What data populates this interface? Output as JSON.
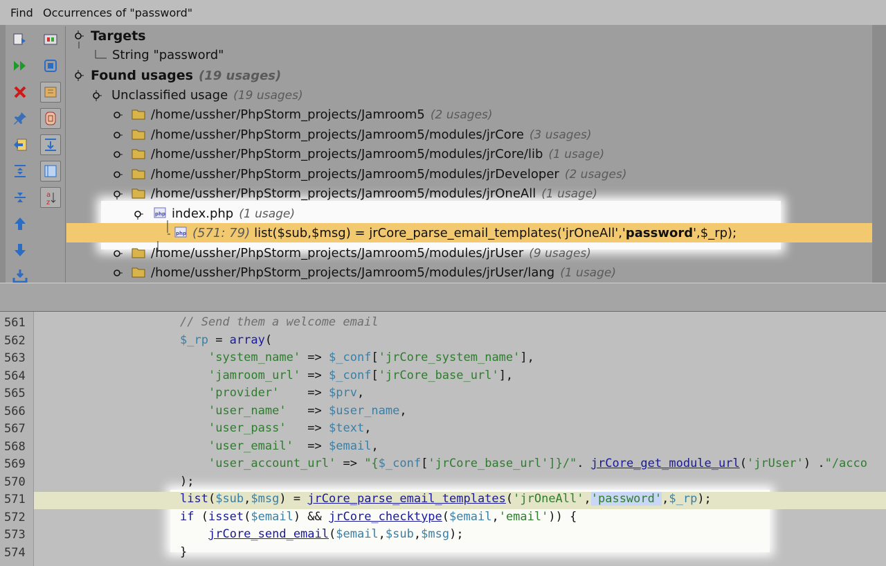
{
  "titlebar": {
    "label": "Find",
    "title": "Occurrences of \"password\""
  },
  "tree": {
    "targets": "Targets",
    "target_item": "String \"password\"",
    "found": "Found usages",
    "found_count": "(19 usages)",
    "unclassified": "Unclassified usage",
    "unclassified_count": "(19 usages)",
    "folders": [
      {
        "path": "/home/ussher/PhpStorm_projects/Jamroom5",
        "count": "(2 usages)"
      },
      {
        "path": "/home/ussher/PhpStorm_projects/Jamroom5/modules/jrCore",
        "count": "(3 usages)"
      },
      {
        "path": "/home/ussher/PhpStorm_projects/Jamroom5/modules/jrCore/lib",
        "count": "(1 usage)"
      },
      {
        "path": "/home/ussher/PhpStorm_projects/Jamroom5/modules/jrDeveloper",
        "count": "(2 usages)"
      },
      {
        "path": "/home/ussher/PhpStorm_projects/Jamroom5/modules/jrOneAll",
        "count": "(1 usage)"
      },
      {
        "path": "/home/ussher/PhpStorm_projects/Jamroom5/modules/jrUser",
        "count": "(9 usages)"
      },
      {
        "path": "/home/ussher/PhpStorm_projects/Jamroom5/modules/jrUser/lang",
        "count": "(1 usage)"
      }
    ],
    "file": "index.php",
    "file_count": "(1 usage)",
    "usage_pos": "(571: 79)",
    "usage_pre": "list($sub,$msg) = jrCore_parse_email_templates('jrOneAll','",
    "usage_match": "password",
    "usage_post": "',$_rp);"
  },
  "editor": {
    "line_numbers": [
      "561",
      "562",
      "563",
      "564",
      "565",
      "566",
      "567",
      "568",
      "569",
      "570",
      "571",
      "572",
      "573",
      "574"
    ],
    "tokens": {
      "l561_comment": "// Send them a welcome email",
      "l562_var": "$_rp",
      "l562_eq": " = ",
      "l562_fn": "array",
      "l562_open": "(",
      "l563_key": "'system_name'",
      "l563_arrow": " => ",
      "l563_var": "$_conf",
      "l563_br": "[",
      "l563_val": "'jrCore_system_name'",
      "l563_end": "],",
      "l564_key": "'jamroom_url'",
      "l564_arrow": " => ",
      "l564_var": "$_conf",
      "l564_br": "[",
      "l564_val": "'jrCore_base_url'",
      "l564_end": "],",
      "l565_key": "'provider'",
      "l565_arrow": "    => ",
      "l565_var": "$prv",
      "l565_end": ",",
      "l566_key": "'user_name'",
      "l566_arrow": "   => ",
      "l566_var": "$user_name",
      "l566_end": ",",
      "l567_key": "'user_pass'",
      "l567_arrow": "   => ",
      "l567_var": "$text",
      "l567_end": ",",
      "l568_key": "'user_email'",
      "l568_arrow": "  => ",
      "l568_var": "$email",
      "l568_end": ",",
      "l569_key": "'user_account_url'",
      "l569_arrow": " => ",
      "l569_q": "\"{",
      "l569_var": "$_conf",
      "l569_br": "[",
      "l569_val": "'jrCore_base_url'",
      "l569_mid": "]}/\"",
      "l569_dot": ". ",
      "l569_fn": "jrCore_get_module_url",
      "l569_p1": "(",
      "l569_arg": "'jrUser'",
      "l569_p2": ") .",
      "l569_tail": "\"/acco",
      "l570_text": ");",
      "l571_fn": "list",
      "l571_p": "(",
      "l571_v1": "$sub",
      "l571_c": ",",
      "l571_v2": "$msg",
      "l571_eq": ") = ",
      "l571_fn2": "jrCore_parse_email_templates",
      "l571_p2": "(",
      "l571_a1": "'jrOneAll'",
      "l571_c2": ",",
      "l571_sel": "'password'",
      "l571_c3": ",",
      "l571_v3": "$_rp",
      "l571_end": ");",
      "l572_kw": "if",
      "l572_p": " (",
      "l572_fn": "isset",
      "l572_p2": "(",
      "l572_v1": "$email",
      "l572_and": ") && ",
      "l572_fn2": "jrCore_checktype",
      "l572_p3": "(",
      "l572_v2": "$email",
      "l572_c": ",",
      "l572_s": "'email'",
      "l572_end": ")) {",
      "l573_fn": "jrCore_send_email",
      "l573_p": "(",
      "l573_v1": "$email",
      "l573_c1": ",",
      "l573_v2": "$sub",
      "l573_c2": ",",
      "l573_v3": "$msg",
      "l573_end": ");",
      "l574_text": "}"
    }
  },
  "toolbar": {
    "left": [
      "rerun-icon",
      "expand-run-icon",
      "close-icon",
      "pin-icon",
      "previous-occurrence-icon",
      "expand-all-icon",
      "collapse-all-icon",
      "up-arrow-icon",
      "down-arrow-icon",
      "export-icon"
    ],
    "right": [
      "preview-icon",
      "stop-icon",
      "group-by-type-icon",
      "group-by-module-icon",
      "group-by-directory-icon",
      "group-by-file-icon",
      "sort-alpha-icon"
    ]
  },
  "colors": {
    "highlight_row": "#f2c96f",
    "panel_bg": "#9e9e9e",
    "editor_bg": "#bfbfbf"
  }
}
